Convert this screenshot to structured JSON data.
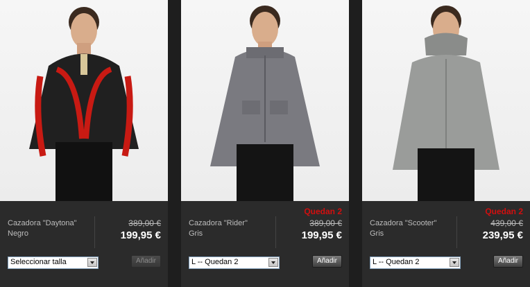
{
  "products": [
    {
      "name": "Cazadora \"Daytona\"",
      "color": "Negro",
      "stock": "",
      "old_price": "389,00 €",
      "price": "199,95 €",
      "size_select": "Seleccionar talla",
      "add_label": "Añadir",
      "jacket_color": "#202020",
      "stripe_color": "#c81a13"
    },
    {
      "name": "Cazadora \"Rider\"",
      "color": "Gris",
      "stock": "Quedan 2",
      "old_price": "389,00 €",
      "price": "199,95 €",
      "size_select": "L -- Quedan 2",
      "add_label": "Añadir",
      "jacket_color": "#7a7a80",
      "stripe_color": ""
    },
    {
      "name": "Cazadora \"Scooter\"",
      "color": "Gris",
      "stock": "Quedan 2",
      "old_price": "439,00 €",
      "price": "239,95 €",
      "size_select": "L -- Quedan 2",
      "add_label": "Añadir",
      "jacket_color": "#9a9c9a",
      "stripe_color": ""
    }
  ]
}
